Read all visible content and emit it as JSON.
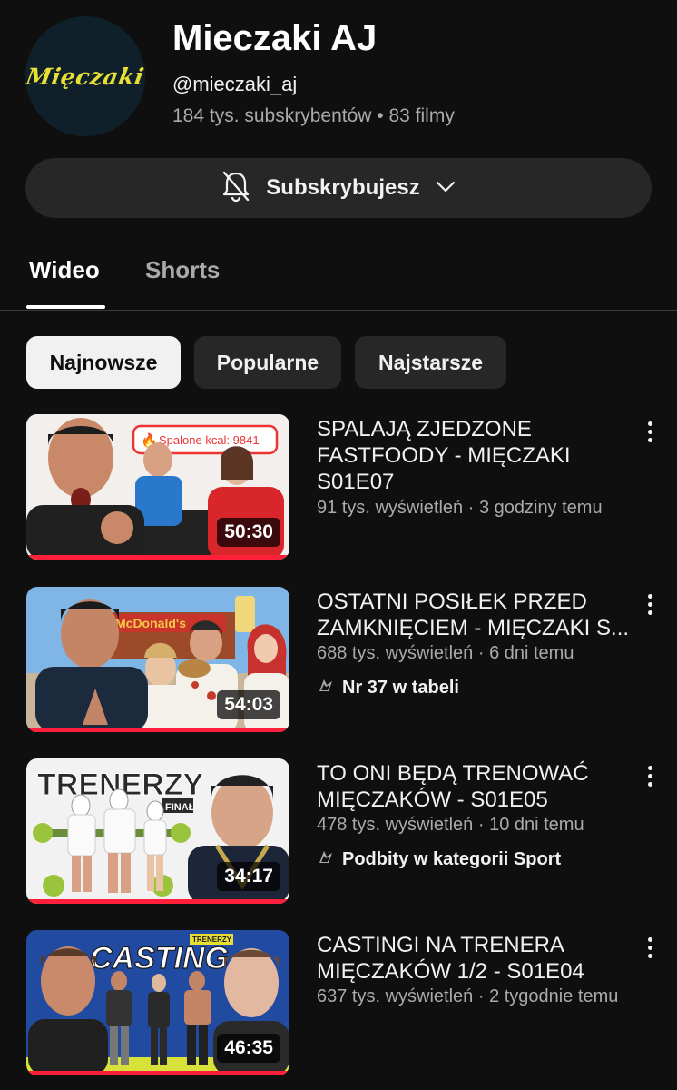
{
  "channel": {
    "logo_text": "Mięczaki",
    "name": "Mieczaki AJ",
    "handle": "@mieczaki_aj",
    "stats": "184 tys. subskrybentów • 83 filmy",
    "subscribe_label": "Subskrybujesz"
  },
  "tabs": [
    {
      "label": "Wideo",
      "active": true
    },
    {
      "label": "Shorts",
      "active": false
    }
  ],
  "filters": [
    {
      "label": "Najnowsze",
      "selected": true
    },
    {
      "label": "Popularne",
      "selected": false
    },
    {
      "label": "Najstarsze",
      "selected": false
    }
  ],
  "videos": [
    {
      "title": "SPALAJĄ ZJEDZONE FASTFOODY - MIĘCZAKI S01E07",
      "meta": "91 tys. wyświetleń · 3 godziny temu",
      "duration": "50:30",
      "thumb_text": "Spalone kcal: 9841",
      "badge": ""
    },
    {
      "title": "OSTATNI POSIŁEK PRZED ZAMKNIĘCIEM - MIĘCZAKI S...",
      "meta": "688 tys. wyświetleń · 6 dni temu",
      "duration": "54:03",
      "thumb_text": "McDonald's",
      "badge": "Nr 37 w tabeli"
    },
    {
      "title": "TO ONI BĘDĄ TRENOWAĆ MIĘCZAKÓW - S01E05",
      "meta": "478 tys. wyświetleń · 10 dni temu",
      "duration": "34:17",
      "thumb_text": "TRENERZY",
      "thumb_sub": "FINAŁ",
      "badge": "Podbity w kategorii Sport"
    },
    {
      "title": "CASTINGI NA TRENERA MIĘCZAKÓW 1/2 - S01E04",
      "meta": "637 tys. wyświetleń · 2 tygodnie temu",
      "duration": "46:35",
      "thumb_text": "CASTING",
      "thumb_sub": "TRENERZY",
      "badge": ""
    }
  ],
  "colors": {
    "background": "#0f0f0f",
    "chip": "#272727",
    "progress": "#ff1f3a",
    "logo": "#e8df35"
  }
}
